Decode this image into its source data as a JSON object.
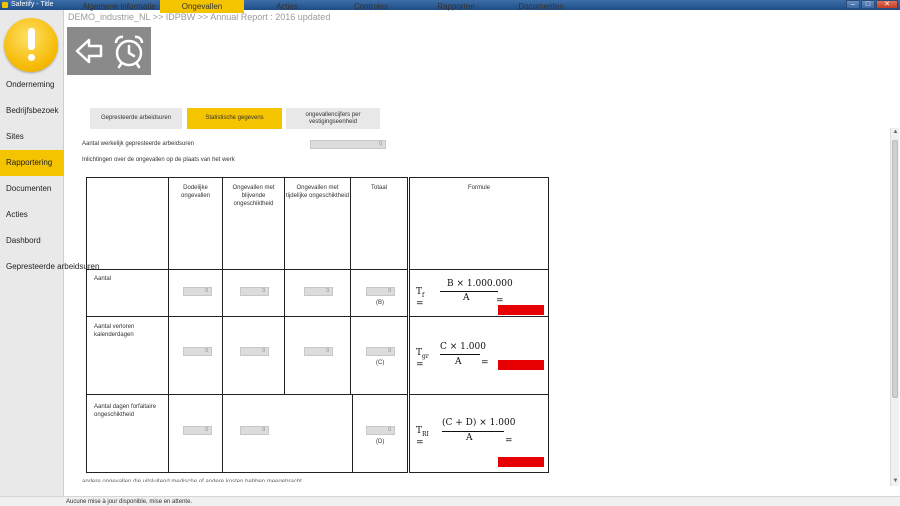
{
  "window": {
    "title": "Safetify - Title",
    "btn_min": "–",
    "btn_max": "□",
    "btn_close": "✕"
  },
  "breadcrumb": "DEMO_industrie_NL >> IDPBW >> Annual Report : 2016 updated",
  "toolbar": {
    "back_icon": "back-arrow-icon",
    "alarm_icon": "alarm-clock-icon"
  },
  "sidebar": {
    "items": [
      {
        "label": "Onderneming"
      },
      {
        "label": "Bedrijfsbezoek"
      },
      {
        "label": "Sites"
      },
      {
        "label": "Rapportering"
      },
      {
        "label": "Documenten"
      },
      {
        "label": "Acties"
      },
      {
        "label": "Dashbord"
      },
      {
        "label": "Gepresteerde arbeidsuren"
      }
    ],
    "active_index": 3
  },
  "tabs": [
    {
      "label": "Algemene informatie"
    },
    {
      "label": "Ongevallen"
    },
    {
      "label": "Acties"
    },
    {
      "label": "Controles"
    },
    {
      "label": "Rapporten"
    },
    {
      "label": "Documenten"
    }
  ],
  "subtabs": [
    {
      "label": "Gepresteerde arbeidsuren"
    },
    {
      "label": "Statistische gegevens"
    },
    {
      "label": "ongevallencijfers per vestigingseenheid"
    }
  ],
  "form": {
    "hours_label": "Aantal werkelijk gepresteerde arbeidsuren",
    "hours_value": "0",
    "info_label": "Inlichtingen over de ongevallen op de plaats van het werk"
  },
  "table": {
    "headers": [
      "Dodelijke ongevallen",
      "Ongevallen met blijvende ongeschiktheid",
      "Ongevallen met tijdelijke ongeschiktheid",
      "Totaal",
      "Formule"
    ],
    "rows": [
      {
        "label": "Aantal",
        "values": [
          "0",
          "0",
          "0",
          "0"
        ],
        "total_tag": "(B)"
      },
      {
        "label": "Aantal verloren kalenderdagen",
        "values": [
          "0",
          "0",
          "0",
          "0"
        ],
        "total_tag": "(C)"
      },
      {
        "label": "Aantal dagen forfaitaire ongeschiktheid",
        "values": [
          "0",
          "0",
          "0"
        ],
        "total_tag": "(D)"
      }
    ],
    "formulas": [
      {
        "lhs": "T",
        "sub": "f",
        "num": "B × 1.000.000",
        "den": "A",
        "eq": "="
      },
      {
        "lhs": "T",
        "sub": "gr",
        "num": "C × 1.000",
        "den": "A",
        "eq": "="
      },
      {
        "lhs": "T",
        "sub": "RI",
        "num": "(C + D) × 1.000",
        "den": "A",
        "eq": "="
      }
    ],
    "result_color": "#e60000"
  },
  "footnote": "andere ongevallen die uitsluitend medische of andere kosten hebben meegebracht",
  "status": "Aucune mise à jour disponible, mise en attente.",
  "colors": {
    "accent": "#f5c400",
    "toolbar": "#8a8a8a",
    "titlebar": "#1e4d86"
  }
}
